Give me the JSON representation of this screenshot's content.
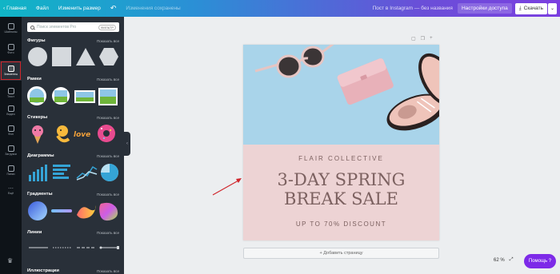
{
  "topbar": {
    "home": "Главная",
    "file": "Файл",
    "resize": "Изменить размер",
    "undo_icon": "undo-icon",
    "saved": "Изменения сохранены",
    "doc_title": "Пост в Instagram — без названия",
    "share": "Настройки доступа",
    "download": "Скачать"
  },
  "rail": {
    "items": [
      {
        "label": "Шаблоны",
        "icon": "templates-icon"
      },
      {
        "label": "Фото",
        "icon": "photo-icon"
      },
      {
        "label": "Элементы",
        "icon": "elements-icon"
      },
      {
        "label": "Текст",
        "icon": "text-icon"
      },
      {
        "label": "Видео",
        "icon": "video-icon"
      },
      {
        "label": "Фон",
        "icon": "background-icon"
      },
      {
        "label": "Загрузки",
        "icon": "upload-icon"
      },
      {
        "label": "Папки",
        "icon": "folder-icon"
      },
      {
        "label": "Ещё",
        "icon": "more-icon"
      }
    ]
  },
  "panel": {
    "search_placeholder": "Поиск элементов Pro",
    "search_badge": "ФИЛЬТР",
    "show_all": "Показать все",
    "sections": [
      "Фигуры",
      "Рамки",
      "Стикеры",
      "Диаграммы",
      "Градиенты",
      "Линии",
      "Иллюстрации"
    ]
  },
  "design": {
    "brand": "FLAIR COLLECTIVE",
    "headline_1": "3-DAY SPRING",
    "headline_2": "BREAK SALE",
    "discount": "UP TO 70% DISCOUNT"
  },
  "canvas": {
    "add_page": "+ Добавить страницу",
    "zoom": "62 %",
    "help": "Помощь ?"
  },
  "colors": {
    "accent": "#7d2ae8",
    "annotation": "#d0262c",
    "design_pink": "#edd3d4",
    "design_text": "#7c6160",
    "photo_bg": "#a9d4ea"
  }
}
